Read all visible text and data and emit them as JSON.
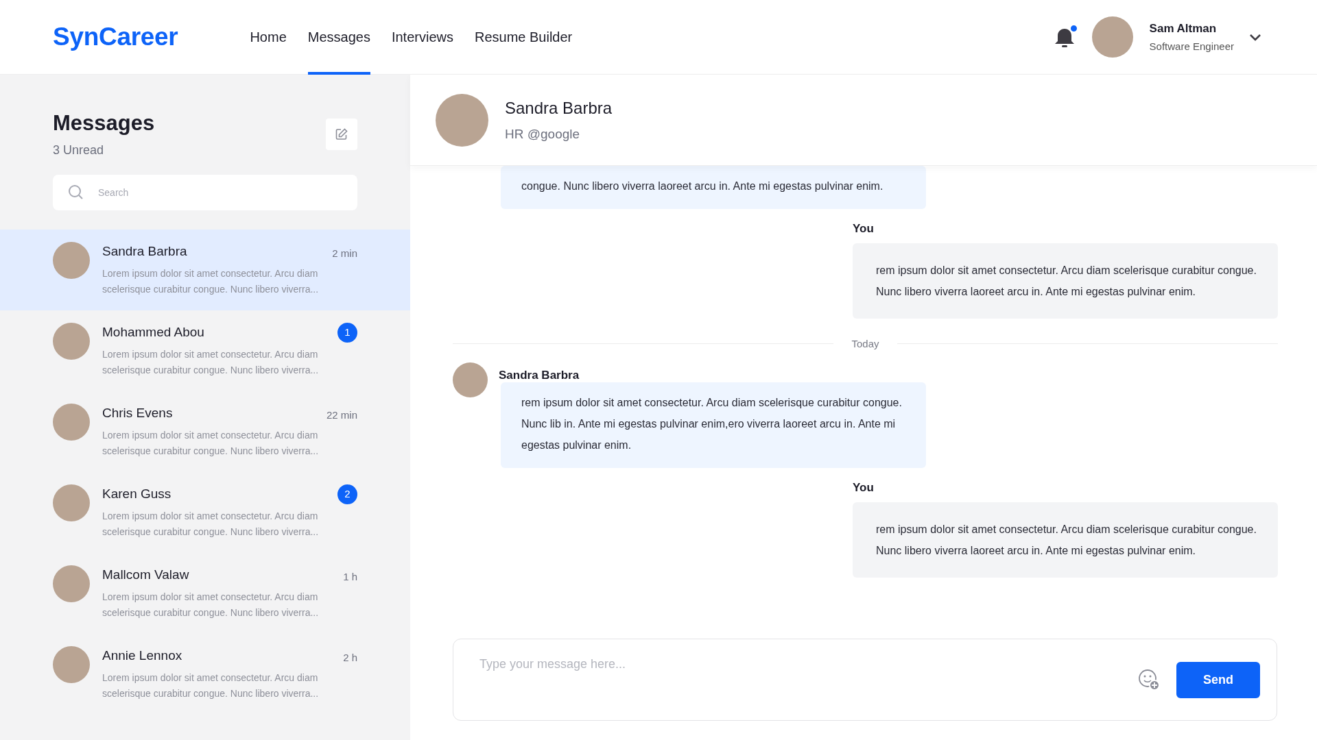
{
  "app": {
    "logo": "SynCareer",
    "nav": [
      {
        "label": "Home",
        "selected": false
      },
      {
        "label": "Messages",
        "selected": true
      },
      {
        "label": "Interviews",
        "selected": false
      },
      {
        "label": "Resume Builder",
        "selected": false
      }
    ],
    "notifications": {
      "unread": true
    },
    "user": {
      "name": "Sam Altman",
      "role": "Software Engineer"
    }
  },
  "sidebar": {
    "title": "Messages",
    "unread": "3 Unread",
    "search": {
      "placeholder": "Search"
    },
    "conversations": [
      {
        "name": "Sandra Barbra",
        "time": "2 min",
        "preview": "Lorem ipsum dolor sit amet consectetur. Arcu diam scelerisque curabitur congue. Nunc libero viverra...",
        "selected": true
      },
      {
        "name": "Mohammed Abou",
        "badge": "1",
        "preview": "Lorem ipsum dolor sit amet consectetur. Arcu diam scelerisque curabitur congue. Nunc libero viverra...",
        "selected": false
      },
      {
        "name": "Chris Evens",
        "time": "22 min",
        "preview": "Lorem ipsum dolor sit amet consectetur. Arcu diam scelerisque curabitur congue. Nunc libero viverra...",
        "selected": false
      },
      {
        "name": "Karen Guss",
        "badge": "2",
        "preview": "Lorem ipsum dolor sit amet consectetur. Arcu diam scelerisque curabitur congue. Nunc libero viverra...",
        "selected": false
      },
      {
        "name": "Mallcom Valaw",
        "time": "1 h",
        "preview": "Lorem ipsum dolor sit amet consectetur. Arcu diam scelerisque curabitur congue. Nunc libero viverra...",
        "selected": false
      },
      {
        "name": "Annie Lennox",
        "time": "2 h",
        "preview": "Lorem ipsum dolor sit amet consectetur. Arcu diam scelerisque curabitur congue. Nunc libero viverra...",
        "selected": false
      }
    ]
  },
  "chat": {
    "contact": {
      "name": "Sandra Barbra",
      "subtitle": "HR @google"
    },
    "messages": [
      {
        "kind": "received",
        "text": "congue. Nunc libero viverra laoreet arcu in. Ante mi egestas pulvinar enim."
      },
      {
        "kind": "sent",
        "sender": "You",
        "text": "rem ipsum dolor sit amet consectetur. Arcu diam scelerisque curabitur congue. Nunc libero viverra laoreet arcu in. Ante mi egestas pulvinar enim."
      },
      {
        "kind": "divider",
        "text": "Today"
      },
      {
        "kind": "received",
        "sender": "Sandra Barbra",
        "text": "rem ipsum dolor sit amet consectetur. Arcu diam scelerisque curabitur congue. Nunc lib in. Ante mi egestas pulvinar enim,ero viverra laoreet arcu in. Ante mi egestas pulvinar enim."
      },
      {
        "kind": "sent",
        "sender": "You",
        "text": "rem ipsum dolor sit amet consectetur. Arcu diam scelerisque curabitur congue. Nunc libero viverra laoreet arcu in. Ante mi egestas pulvinar enim."
      }
    ],
    "composer": {
      "placeholder": "Type your message here...",
      "send": "Send"
    }
  }
}
